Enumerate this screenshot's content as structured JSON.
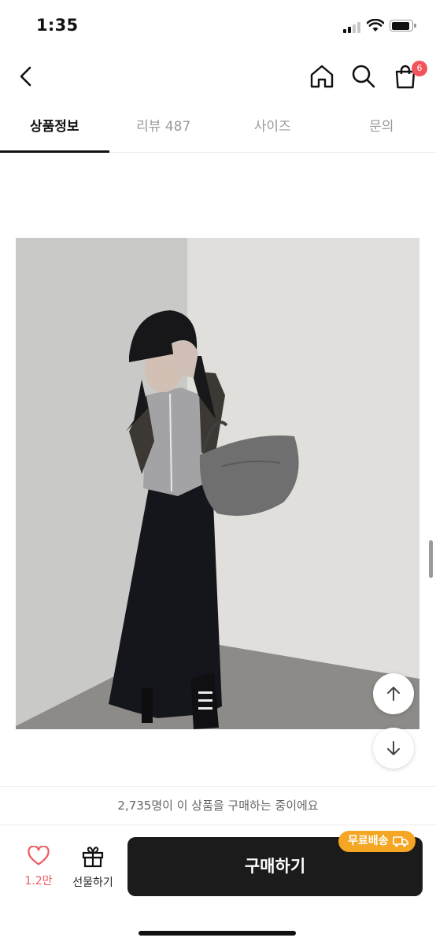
{
  "status": {
    "time": "1:35"
  },
  "nav": {
    "cart_count": "6"
  },
  "tabs": [
    {
      "label": "상품정보",
      "active": true
    },
    {
      "label": "리뷰 487",
      "active": false
    },
    {
      "label": "사이즈",
      "active": false
    },
    {
      "label": "문의",
      "active": false
    }
  ],
  "notice": {
    "text": "2,735명이 이 상품을 구매하는 중이에요"
  },
  "bottom": {
    "like_count": "1.2만",
    "gift_label": "선물하기",
    "buy_label": "구매하기",
    "free_shipping": "무료배송"
  },
  "icons": [
    "back-chevron-icon",
    "home-icon",
    "search-icon",
    "shopping-bag-icon",
    "arrow-up-icon",
    "arrow-down-icon",
    "heart-icon",
    "gift-icon",
    "truck-icon"
  ],
  "colors": {
    "badge": "#f2545b",
    "like": "#ef5b60",
    "buy_button": "#1b1b1b",
    "free_shipping": "#f5a623"
  }
}
